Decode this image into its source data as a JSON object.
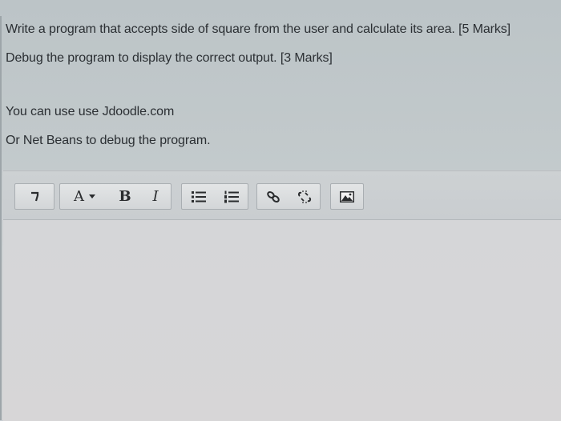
{
  "question": {
    "line1": "Write a program that accepts side of square from the user and calculate its area. [5 Marks]",
    "line2": "Debug the program to display the correct output. [3 Marks]",
    "line3": "You can use  use Jdoodle.com",
    "line4": "Or Net Beans to debug the program."
  },
  "toolbar": {
    "paragraph_icon": "paragraph-format-icon",
    "font_label": "A",
    "bold_label": "B",
    "italic_label": "I",
    "bullet_list_icon": "bullet-list-icon",
    "numbered_list_icon": "numbered-list-icon",
    "link_icon": "link-icon",
    "unlink_icon": "unlink-icon",
    "image_icon": "image-icon"
  },
  "editor": {
    "body_text": ""
  }
}
